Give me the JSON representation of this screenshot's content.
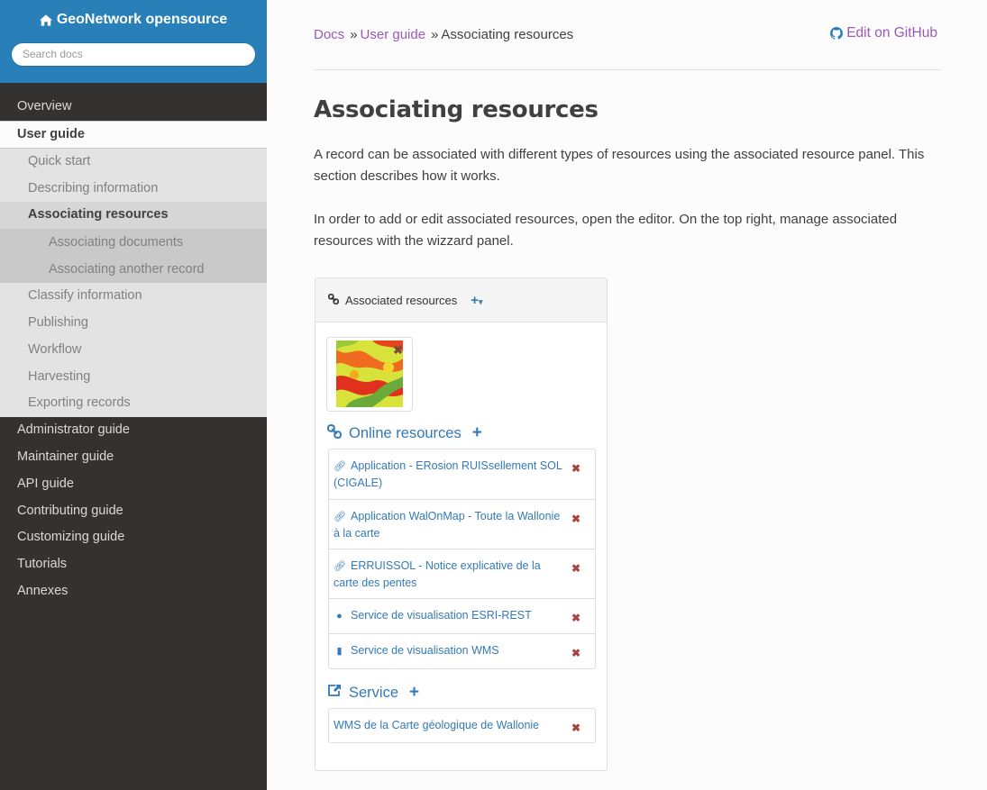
{
  "sidebar": {
    "brand": "GeoNetwork opensource",
    "search_placeholder": "Search docs",
    "items": {
      "overview": "Overview",
      "user_guide": "User guide",
      "quick_start": "Quick start",
      "describing": "Describing information",
      "associating": "Associating resources",
      "assoc_docs": "Associating documents",
      "assoc_record": "Associating another record",
      "classify": "Classify information",
      "publishing": "Publishing",
      "workflow": "Workflow",
      "harvesting": "Harvesting",
      "exporting": "Exporting records",
      "admin": "Administrator guide",
      "maintainer": "Maintainer guide",
      "api": "API guide",
      "contributing": "Contributing guide",
      "customizing": "Customizing guide",
      "tutorials": "Tutorials",
      "annexes": "Annexes"
    }
  },
  "breadcrumb": {
    "docs": "Docs",
    "user_guide": "User guide",
    "current": "Associating resources",
    "separator": "»",
    "edit": "Edit on GitHub"
  },
  "content": {
    "title": "Associating resources",
    "para1": "A record can be associated with different types of resources using the associated resource panel. This section describes how it works.",
    "para2": "In order to add or edit associated resources, open the editor. On the top right, manage associated resources with the wizzard panel."
  },
  "panel": {
    "header": "Associated resources",
    "online_title": "Online resources",
    "online": [
      {
        "label": "Application - ERosion RUISsellement SOL (CIGALE)",
        "icon": "link-icon"
      },
      {
        "label": "Application WalOnMap - Toute la Wallonie à la carte",
        "icon": "link-icon"
      },
      {
        "label": "ERRUISSOL - Notice explicative de la carte des pentes",
        "icon": "link-icon"
      },
      {
        "label": "Service de visualisation ESRI-REST",
        "icon": "globe-icon"
      },
      {
        "label": "Service de visualisation WMS",
        "icon": "map-icon"
      }
    ],
    "service_title": "Service",
    "services": [
      {
        "label": "WMS de la Carte géologique de Wallonie"
      }
    ]
  },
  "colors": {
    "sidebar_bg": "#343131",
    "brand_bg": "#2980b9",
    "link_purple": "#9b59b6",
    "panel_blue": "#337ab7",
    "delete_red": "#a94442"
  }
}
